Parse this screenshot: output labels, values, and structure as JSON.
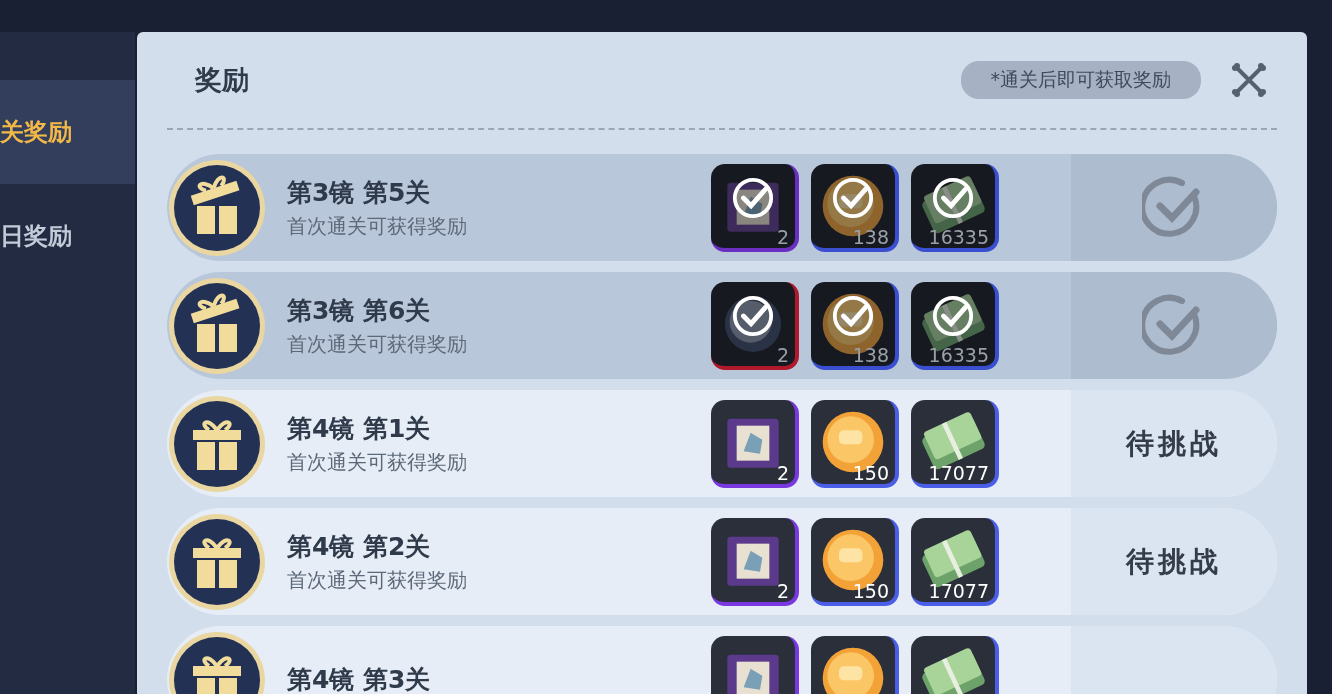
{
  "sidebar": {
    "items": [
      {
        "label": "关奖励",
        "selected": true
      },
      {
        "label": "日奖励",
        "selected": false
      }
    ]
  },
  "panel": {
    "title": "奖励",
    "notice": "*通关后即可获取奖励"
  },
  "rows": [
    {
      "title": "第3镜  第5关",
      "subtitle": "首次通关可获得奖励",
      "claimed": true,
      "rewards": [
        {
          "kind": "box",
          "count": "2",
          "color": "#6a2fc0"
        },
        {
          "kind": "coin",
          "count": "138",
          "color": "#3a4fd0"
        },
        {
          "kind": "cash",
          "count": "16335",
          "color": "#3a4fd0"
        }
      ]
    },
    {
      "title": "第3镜  第6关",
      "subtitle": "首次通关可获得奖励",
      "claimed": true,
      "rewards": [
        {
          "kind": "orb",
          "count": "2",
          "color": "#b0182c"
        },
        {
          "kind": "coin",
          "count": "138",
          "color": "#3a4fd0"
        },
        {
          "kind": "cash",
          "count": "16335",
          "color": "#3a4fd0"
        }
      ]
    },
    {
      "title": "第4镜  第1关",
      "subtitle": "首次通关可获得奖励",
      "claimed": false,
      "status": "待挑战",
      "rewards": [
        {
          "kind": "box",
          "count": "2",
          "color": "#7a38e0"
        },
        {
          "kind": "coin",
          "count": "150",
          "color": "#4a5ee8"
        },
        {
          "kind": "cash",
          "count": "17077",
          "color": "#4a5ee8"
        }
      ]
    },
    {
      "title": "第4镜  第2关",
      "subtitle": "首次通关可获得奖励",
      "claimed": false,
      "status": "待挑战",
      "rewards": [
        {
          "kind": "box",
          "count": "2",
          "color": "#7a38e0"
        },
        {
          "kind": "coin",
          "count": "150",
          "color": "#4a5ee8"
        },
        {
          "kind": "cash",
          "count": "17077",
          "color": "#4a5ee8"
        }
      ]
    },
    {
      "title": "第4镜  第3关",
      "claimed": false,
      "rewards": [
        {
          "kind": "box",
          "color": "#7a38e0"
        },
        {
          "kind": "coin",
          "color": "#4a5ee8"
        },
        {
          "kind": "cash",
          "color": "#4a5ee8"
        }
      ]
    }
  ]
}
